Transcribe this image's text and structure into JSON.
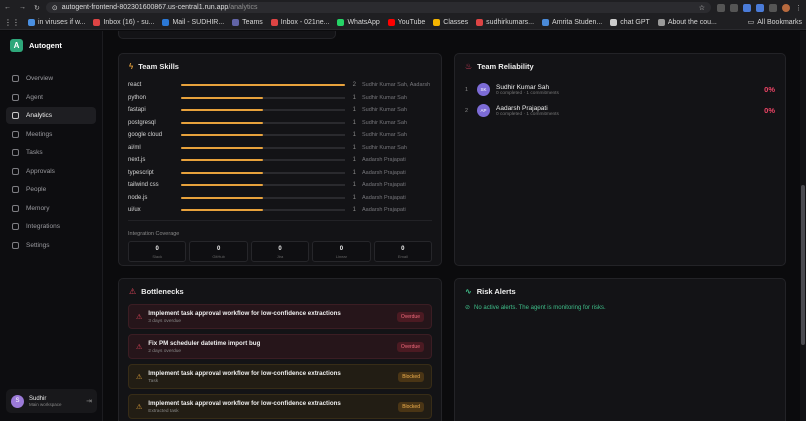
{
  "browser": {
    "url_host": "autogent-frontend-802301600867.us-central1.run.app",
    "url_path": "/analytics",
    "bookmarks": [
      {
        "label": "in viruses if w...",
        "color": "#4a90e2"
      },
      {
        "label": "Inbox (16) - su...",
        "color": "#d44"
      },
      {
        "label": "Mail - SUDHIR...",
        "color": "#2b78d6"
      },
      {
        "label": "Teams",
        "color": "#6264a7"
      },
      {
        "label": "Inbox - 021ne...",
        "color": "#d44"
      },
      {
        "label": "WhatsApp",
        "color": "#25d366"
      },
      {
        "label": "YouTube",
        "color": "#f00"
      },
      {
        "label": "Classes",
        "color": "#f4b400"
      },
      {
        "label": "sudhirkumars...",
        "color": "#d44"
      },
      {
        "label": "Amrita Studen...",
        "color": "#4a8ad8"
      },
      {
        "label": "chat GPT",
        "color": "#ccc"
      },
      {
        "label": "About the cou...",
        "color": "#999"
      }
    ],
    "all_bookmarks_label": "All Bookmarks"
  },
  "brand": {
    "logo": "A",
    "name": "Autogent"
  },
  "nav": [
    {
      "label": "Overview",
      "icon": "grid-icon",
      "active": false
    },
    {
      "label": "Agent",
      "icon": "bot-icon",
      "active": false
    },
    {
      "label": "Analytics",
      "icon": "chart-icon",
      "active": true
    },
    {
      "label": "Meetings",
      "icon": "calendar-icon",
      "active": false
    },
    {
      "label": "Tasks",
      "icon": "tasks-icon",
      "active": false
    },
    {
      "label": "Approvals",
      "icon": "check-icon",
      "active": false
    },
    {
      "label": "People",
      "icon": "people-icon",
      "active": false
    },
    {
      "label": "Memory",
      "icon": "memory-icon",
      "active": false
    },
    {
      "label": "Integrations",
      "icon": "plug-icon",
      "active": false
    },
    {
      "label": "Settings",
      "icon": "gear-icon",
      "active": false
    }
  ],
  "user": {
    "initial": "S",
    "name": "Sudhir",
    "workspace": "Main workspace"
  },
  "skills": {
    "title": "Team Skills",
    "accent": "#e8a23c",
    "max": 2,
    "rows": [
      {
        "name": "react",
        "count": 2,
        "people": "Sudhir Kumar Sah, Aadarsh Prajapati"
      },
      {
        "name": "python",
        "count": 1,
        "people": "Sudhir Kumar Sah"
      },
      {
        "name": "fastapi",
        "count": 1,
        "people": "Sudhir Kumar Sah"
      },
      {
        "name": "postgresql",
        "count": 1,
        "people": "Sudhir Kumar Sah"
      },
      {
        "name": "google cloud",
        "count": 1,
        "people": "Sudhir Kumar Sah"
      },
      {
        "name": "ai/ml",
        "count": 1,
        "people": "Sudhir Kumar Sah"
      },
      {
        "name": "next.js",
        "count": 1,
        "people": "Aadarsh Prajapati"
      },
      {
        "name": "typescript",
        "count": 1,
        "people": "Aadarsh Prajapati"
      },
      {
        "name": "tailwind css",
        "count": 1,
        "people": "Aadarsh Prajapati"
      },
      {
        "name": "node.js",
        "count": 1,
        "people": "Aadarsh Prajapati"
      },
      {
        "name": "ui/ux",
        "count": 1,
        "people": "Aadarsh Prajapati"
      }
    ],
    "coverage_title": "Integration Coverage",
    "coverage": [
      {
        "value": "0",
        "label": "Slack"
      },
      {
        "value": "0",
        "label": "GitHub"
      },
      {
        "value": "0",
        "label": "Jira"
      },
      {
        "value": "0",
        "label": "Linear"
      },
      {
        "value": "0",
        "label": "Email"
      }
    ]
  },
  "reliability": {
    "title": "Team Reliability",
    "rows": [
      {
        "rank": "1",
        "initials": "SK",
        "name": "Sudhir Kumar Sah",
        "sub": "0 completed · 1 commitments",
        "pct": "0%"
      },
      {
        "rank": "2",
        "initials": "AP",
        "name": "Aadarsh Prajapati",
        "sub": "0 completed · 1 commitments",
        "pct": "0%"
      }
    ]
  },
  "bottlenecks": {
    "title": "Bottlenecks",
    "items": [
      {
        "title": "Implement task approval workflow for low-confidence extractions",
        "sub": "3 days overdue",
        "status": "Overdue",
        "kind": "overdue"
      },
      {
        "title": "Fix PM scheduler datetime import bug",
        "sub": "2 days overdue",
        "status": "Overdue",
        "kind": "overdue"
      },
      {
        "title": "Implement task approval workflow for low-confidence extractions",
        "sub": "Task",
        "status": "Blocked",
        "kind": "blocked"
      },
      {
        "title": "Implement task approval workflow for low-confidence extractions",
        "sub": "Extracted task",
        "status": "Blocked",
        "kind": "blocked"
      }
    ]
  },
  "risk": {
    "title": "Risk Alerts",
    "message": "No active alerts. The agent is monitoring for risks."
  }
}
